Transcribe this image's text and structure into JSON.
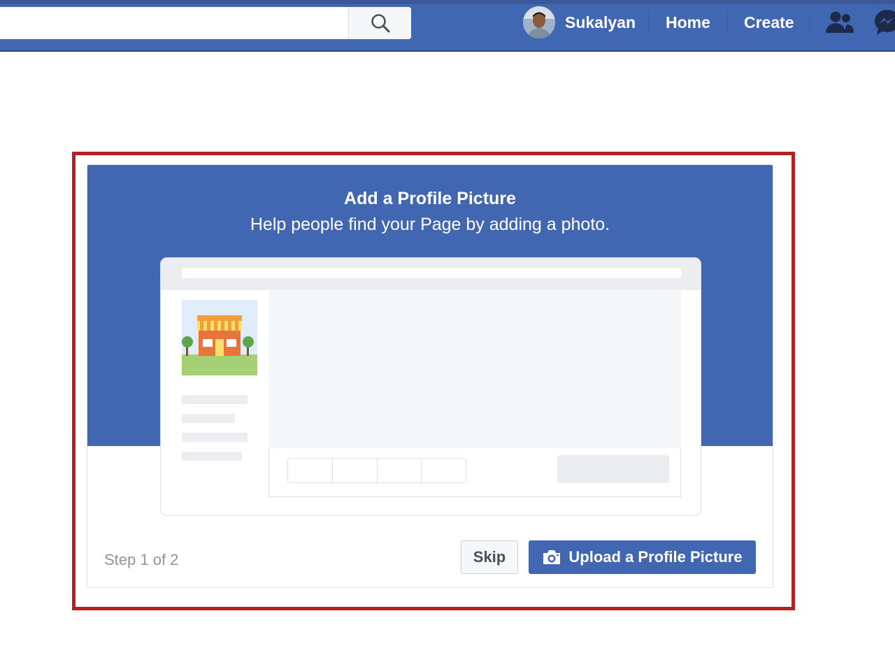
{
  "colors": {
    "brand": "#4267b2",
    "highlight": "#b52025",
    "step_text": "#90949c"
  },
  "header": {
    "search": {
      "value": "",
      "placeholder": "",
      "button_icon": "search-icon"
    },
    "user_name": "Sukalyan",
    "nav": {
      "home": "Home",
      "create": "Create"
    },
    "icons": [
      "friends-icon",
      "messenger-icon"
    ]
  },
  "dialog": {
    "title": "Add a Profile Picture",
    "subtitle": "Help people find your Page by adding a photo.",
    "step": "Step 1 of 2",
    "skip_label": "Skip",
    "upload_label": "Upload a Profile Picture",
    "upload_icon": "camera-icon",
    "illustration": "page-preview-illustration"
  }
}
